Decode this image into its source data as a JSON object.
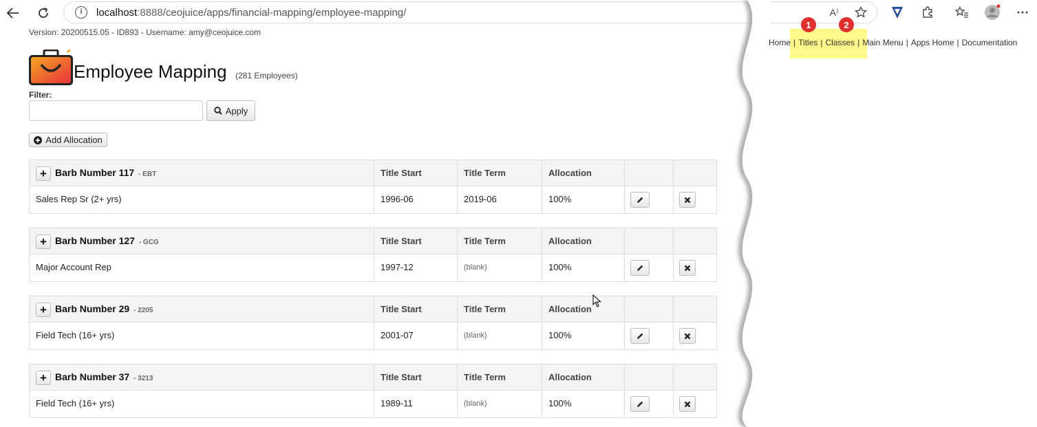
{
  "browser": {
    "url_host": "localhost",
    "url_port": ":8888",
    "url_path": "/ceojuice/apps/financial-mapping/employee-mapping/",
    "read_aloud_label": "A⁾"
  },
  "page": {
    "meta_line": "Version: 20200515.05 - ID893 - Username: amy@ceojuice.com",
    "title": "Employee Mapping",
    "employee_count": "(281 Employees)",
    "filter_label": "Filter:",
    "filter_value": "",
    "apply_label": "Apply",
    "add_allocation_label": "Add Allocation"
  },
  "nav": {
    "items": [
      "Home",
      "Titles",
      "Classes",
      "Main Menu",
      "Apps Home",
      "Documentation"
    ],
    "separator": "|",
    "badges": [
      "1",
      "2"
    ]
  },
  "table_headers": {
    "title_start": "Title Start",
    "title_term": "Title Term",
    "allocation": "Allocation"
  },
  "employees": [
    {
      "name": "Barb Number 117",
      "code": "- EBT",
      "title": "Sales Rep Sr (2+ yrs)",
      "start": "1996-06",
      "term": "2019-06",
      "term_blank": false,
      "allocation": "100%"
    },
    {
      "name": "Barb Number 127",
      "code": "- GCG",
      "title": "Major Account Rep",
      "start": "1997-12",
      "term": "(blank)",
      "term_blank": true,
      "allocation": "100%"
    },
    {
      "name": "Barb Number 29",
      "code": "- 2205",
      "title": "Field Tech (16+ yrs)",
      "start": "2001-07",
      "term": "(blank)",
      "term_blank": true,
      "allocation": "100%"
    },
    {
      "name": "Barb Number 37",
      "code": "- 3213",
      "title": "Field Tech (16+ yrs)",
      "start": "1989-11",
      "term": "(blank)",
      "term_blank": true,
      "allocation": "100%"
    }
  ],
  "colors": {
    "highlight": "#fef98a",
    "badge": "#e0302d",
    "header_bg": "#f4f4f4"
  }
}
